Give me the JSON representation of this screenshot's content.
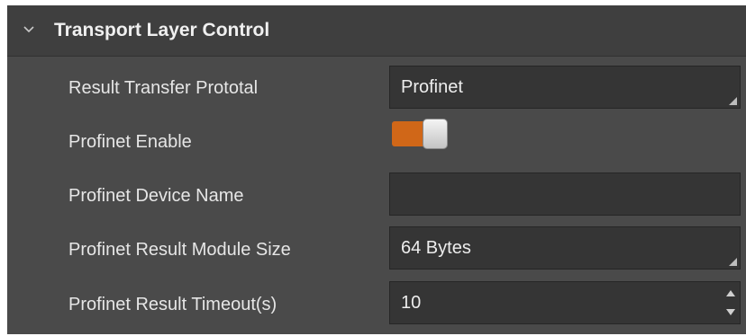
{
  "section": {
    "title": "Transport Layer Control",
    "expand_icon": "chevron-down-icon",
    "expanded": true
  },
  "rows": {
    "result_transfer_protocol": {
      "label": "Result Transfer Prototal",
      "value": "Profinet"
    },
    "profinet_enable": {
      "label": "Profinet Enable",
      "checked": true
    },
    "profinet_device_name": {
      "label": "Profinet Device Name",
      "value": ""
    },
    "profinet_result_module_size": {
      "label": "Profinet Result Module Size",
      "value": "64 Bytes"
    },
    "profinet_result_timeout": {
      "label": "Profinet Result Timeout(s)",
      "value": "10"
    }
  },
  "colors": {
    "panel_background": "#4a4a4a",
    "header_background": "#3f3f3f",
    "field_background": "#353535",
    "toggle_on": "#d06718",
    "text": "#e6e6e6"
  }
}
